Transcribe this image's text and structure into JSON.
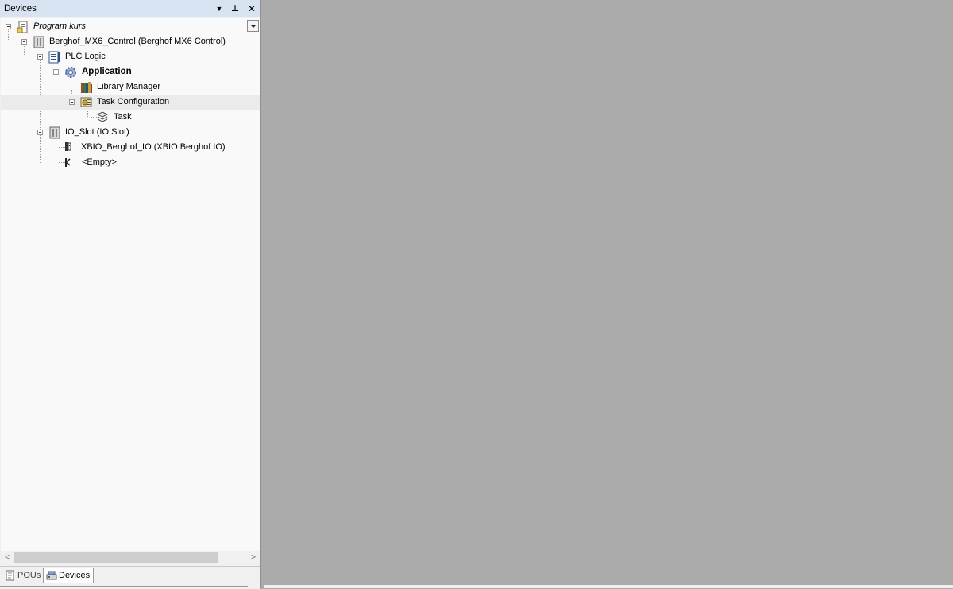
{
  "panel": {
    "title": "Devices",
    "buttons": {
      "dropdown": "▼",
      "pin": "⊥",
      "close": "✕"
    }
  },
  "tree": {
    "project": "Program kurs",
    "controller": "Berghof_MX6_Control (Berghof MX6 Control)",
    "plc_logic": "PLC Logic",
    "application": "Application",
    "library_manager": "Library Manager",
    "task_configuration": "Task Configuration",
    "task": "Task",
    "io_slot": "IO_Slot (IO Slot)",
    "xbio": "XBIO_Berghof_IO (XBIO Berghof IO)",
    "empty": "<Empty>"
  },
  "scrollbar": {
    "left_arrow": "<",
    "right_arrow": ">"
  },
  "tabs": [
    {
      "label": "POUs",
      "active": false
    },
    {
      "label": "Devices",
      "active": true
    }
  ],
  "colors": {
    "workspace": "#ababab",
    "titlebar": "#d7e3f1",
    "tree_background": "#f9f9f9",
    "selected_row": "#ebebeb"
  }
}
